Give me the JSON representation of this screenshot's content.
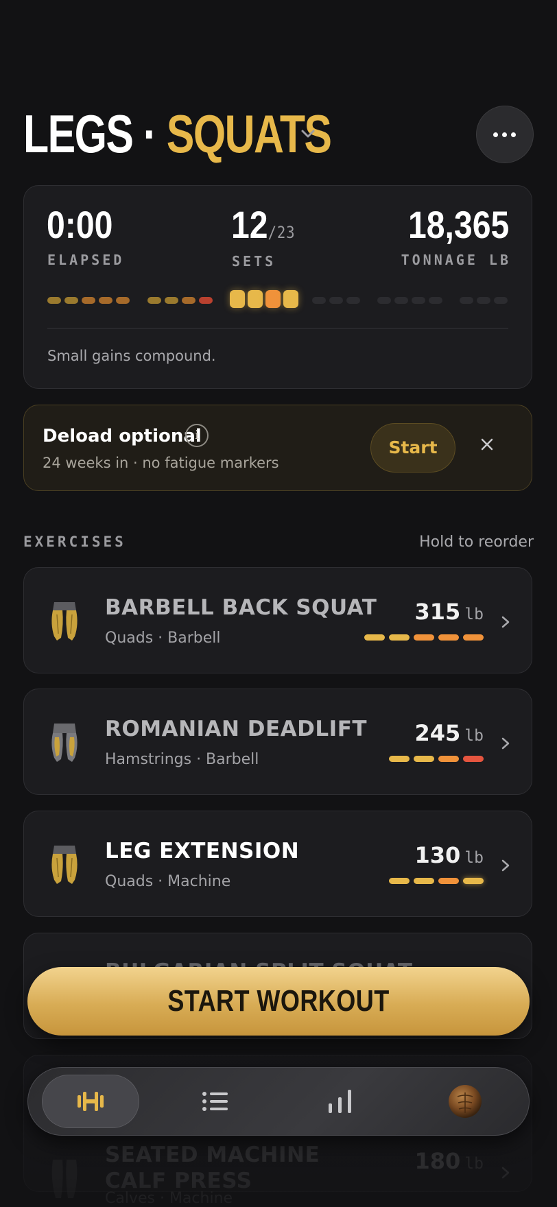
{
  "header": {
    "title_part1": "LEGS",
    "separator": " · ",
    "title_part2": "SQUATS",
    "chevron_icon": "chevron-down-icon",
    "more_icon": "more-horizontal-icon"
  },
  "stats": {
    "elapsed_value": "0:00",
    "elapsed_label": "ELAPSED",
    "sets_done": "12",
    "sets_total": "/23",
    "sets_label": "SETS",
    "tonnage_value": "18,365",
    "tonnage_label": "TONNAGE LB",
    "motto": "Small gains compound."
  },
  "deload": {
    "title": "Deload optional",
    "subtitle": "24 weeks in · no fatigue markers",
    "start_label": "Start",
    "info_icon": "info-icon",
    "close_icon": "close-icon"
  },
  "exercises_section": {
    "title": "EXERCISES",
    "hint": "Hold to reorder"
  },
  "exercises": [
    {
      "name": "BARBELL BACK SQUAT",
      "meta": "Quads · Barbell",
      "weight": "315",
      "unit": "lb"
    },
    {
      "name": "ROMANIAN DEADLIFT",
      "meta": "Hamstrings · Barbell",
      "weight": "245",
      "unit": "lb"
    },
    {
      "name": "LEG EXTENSION",
      "meta": "Quads · Machine",
      "weight": "130",
      "unit": "lb"
    },
    {
      "name": "BULGARIAN SPLIT SQUAT",
      "meta": "",
      "weight": "",
      "unit": ""
    },
    {
      "name": "SEATED MACHINE CALF PRESS",
      "meta": "Calves · Machine",
      "weight": "180",
      "unit": "lb"
    }
  ],
  "cta": {
    "label": "START WORKOUT"
  },
  "nav": {
    "items": [
      "dumbbell-icon",
      "list-icon",
      "bar-chart-icon",
      "profile-avatar"
    ],
    "active": 0
  },
  "colors": {
    "accent": "#e7b84a",
    "orange": "#f0923a",
    "red": "#e5553f",
    "background": "#121214"
  }
}
